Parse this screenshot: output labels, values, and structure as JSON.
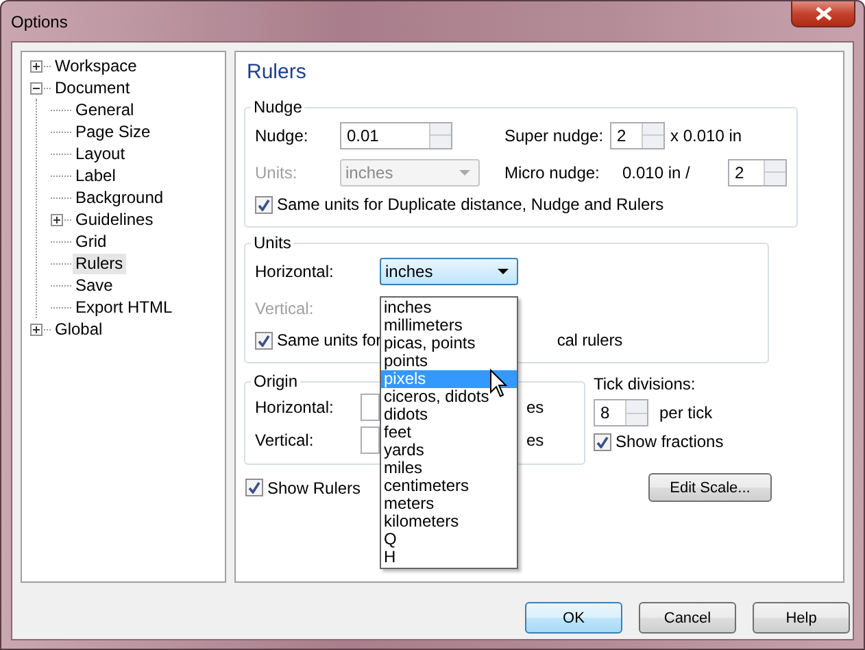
{
  "window": {
    "title": "Options"
  },
  "tree": [
    {
      "label": "Workspace",
      "expanded": false,
      "selected": false
    },
    {
      "label": "Document",
      "expanded": true,
      "selected": false,
      "children": [
        {
          "label": "General",
          "selected": false,
          "has_children": false
        },
        {
          "label": "Page Size",
          "selected": false,
          "has_children": false
        },
        {
          "label": "Layout",
          "selected": false,
          "has_children": false
        },
        {
          "label": "Label",
          "selected": false,
          "has_children": false
        },
        {
          "label": "Background",
          "selected": false,
          "has_children": false
        },
        {
          "label": "Guidelines",
          "selected": false,
          "has_children": true
        },
        {
          "label": "Grid",
          "selected": false,
          "has_children": false
        },
        {
          "label": "Rulers",
          "selected": true,
          "has_children": false
        },
        {
          "label": "Save",
          "selected": false,
          "has_children": false
        },
        {
          "label": "Export HTML",
          "selected": false,
          "has_children": false
        }
      ]
    },
    {
      "label": "Global",
      "expanded": false,
      "selected": false
    }
  ],
  "page_title": "Rulers",
  "nudge": {
    "title": "Nudge",
    "nudge_label": "Nudge:",
    "nudge_value": "0.01",
    "super_label": "Super nudge:",
    "super_value": "2",
    "super_suffix": "x 0.010 in",
    "units_label": "Units:",
    "units_value": "inches",
    "units_disabled": true,
    "micro_label": "Micro nudge:",
    "micro_prefix": "0.010 in /",
    "micro_value": "2",
    "same_units": {
      "label": "Same units for Duplicate distance, Nudge and Rulers",
      "checked": true
    }
  },
  "units": {
    "title": "Units",
    "horizontal_label": "Horizontal:",
    "horizontal_value": "inches",
    "vertical_label": "Vertical:",
    "vertical_disabled": true,
    "same_units": {
      "label": "Same units for",
      "label_tail": "cal rulers",
      "checked": true
    }
  },
  "dropdown": {
    "options": [
      {
        "label": "inches",
        "selected": false
      },
      {
        "label": "millimeters",
        "selected": false
      },
      {
        "label": "picas, points",
        "selected": false
      },
      {
        "label": "points",
        "selected": false
      },
      {
        "label": "pixels",
        "selected": true
      },
      {
        "label": "ciceros, didots",
        "selected": false
      },
      {
        "label": "didots",
        "selected": false
      },
      {
        "label": "feet",
        "selected": false
      },
      {
        "label": "yards",
        "selected": false
      },
      {
        "label": "miles",
        "selected": false
      },
      {
        "label": "centimeters",
        "selected": false
      },
      {
        "label": "meters",
        "selected": false
      },
      {
        "label": "kilometers",
        "selected": false
      },
      {
        "label": "Q",
        "selected": false
      },
      {
        "label": "H",
        "selected": false
      }
    ]
  },
  "origin": {
    "title": "Origin",
    "rows": [
      {
        "label": "Horizontal:",
        "unit": "es"
      },
      {
        "label": "Vertical:",
        "unit": "es"
      }
    ]
  },
  "tick": {
    "label": "Tick divisions:",
    "value": "8",
    "suffix": "per tick",
    "show_fractions": {
      "label": "Show fractions",
      "checked": true
    }
  },
  "show_rulers": {
    "label": "Show Rulers",
    "checked": true
  },
  "edit_scale": "Edit Scale...",
  "buttons": [
    {
      "label": "OK",
      "default": true
    },
    {
      "label": "Cancel",
      "default": false
    },
    {
      "label": "Help",
      "default": false
    }
  ]
}
